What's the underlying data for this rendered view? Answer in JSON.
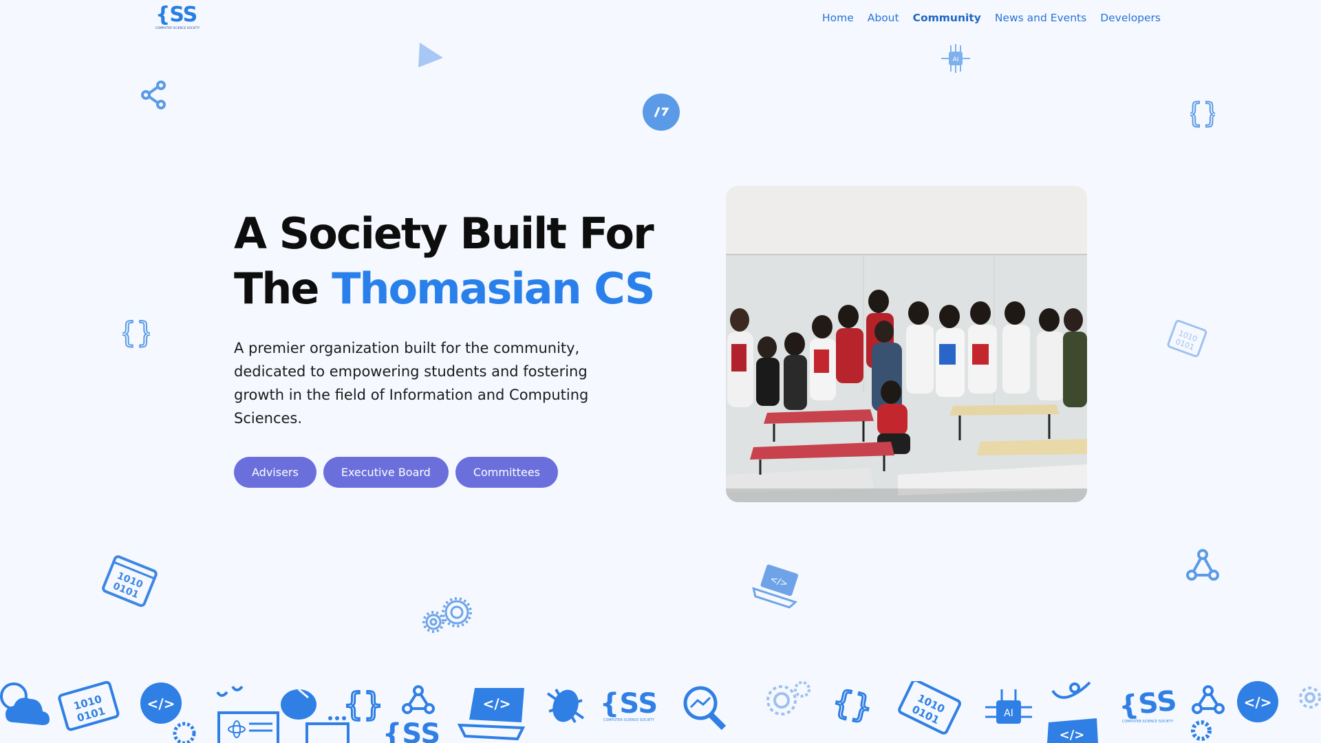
{
  "brand": {
    "logo_text": "{SS",
    "logo_subtext": "COMPUTER SCIENCE SOCIETY"
  },
  "nav": {
    "items": [
      "Home",
      "About",
      "Community",
      "News and Events",
      "Developers"
    ],
    "active": "Community"
  },
  "hero": {
    "headline_line1": "A Society Built For",
    "headline_line2_plain": "The ",
    "headline_line2_accent": "Thomasian CS",
    "description": "A premier organization built for the community, dedicated to empowering students and fostering growth in the field of Information and Computing Sciences.",
    "buttons": [
      "Advisers",
      "Executive Board",
      "Committees"
    ]
  },
  "colors": {
    "background": "#f5f9ff",
    "accent": "#2a80ea",
    "button": "#6b6fdc",
    "nav_link": "#2a72d6"
  },
  "icons": {
    "floating": [
      "share-nodes-icon",
      "triangle-icon",
      "code-circle-icon",
      "ai-chip-icon",
      "curly-braces-icon",
      "binary-card-icon",
      "gears-icon",
      "laptop-code-icon",
      "share-nodes-icon"
    ],
    "strip": [
      "cloud-globe-icon",
      "binary-card-icon",
      "code-circle-icon",
      "atom-document-icon",
      "mouse-icon",
      "curly-braces-icon",
      "share-nodes-icon",
      "css-logo-icon",
      "laptop-code-icon",
      "bug-icon",
      "css-logo-icon",
      "search-chart-icon",
      "gears-icon",
      "curly-braces-icon",
      "binary-card-icon",
      "ai-chip-icon",
      "rocket-icon",
      "css-logo-icon",
      "share-nodes-icon",
      "code-circle-icon",
      "gears-icon"
    ]
  }
}
